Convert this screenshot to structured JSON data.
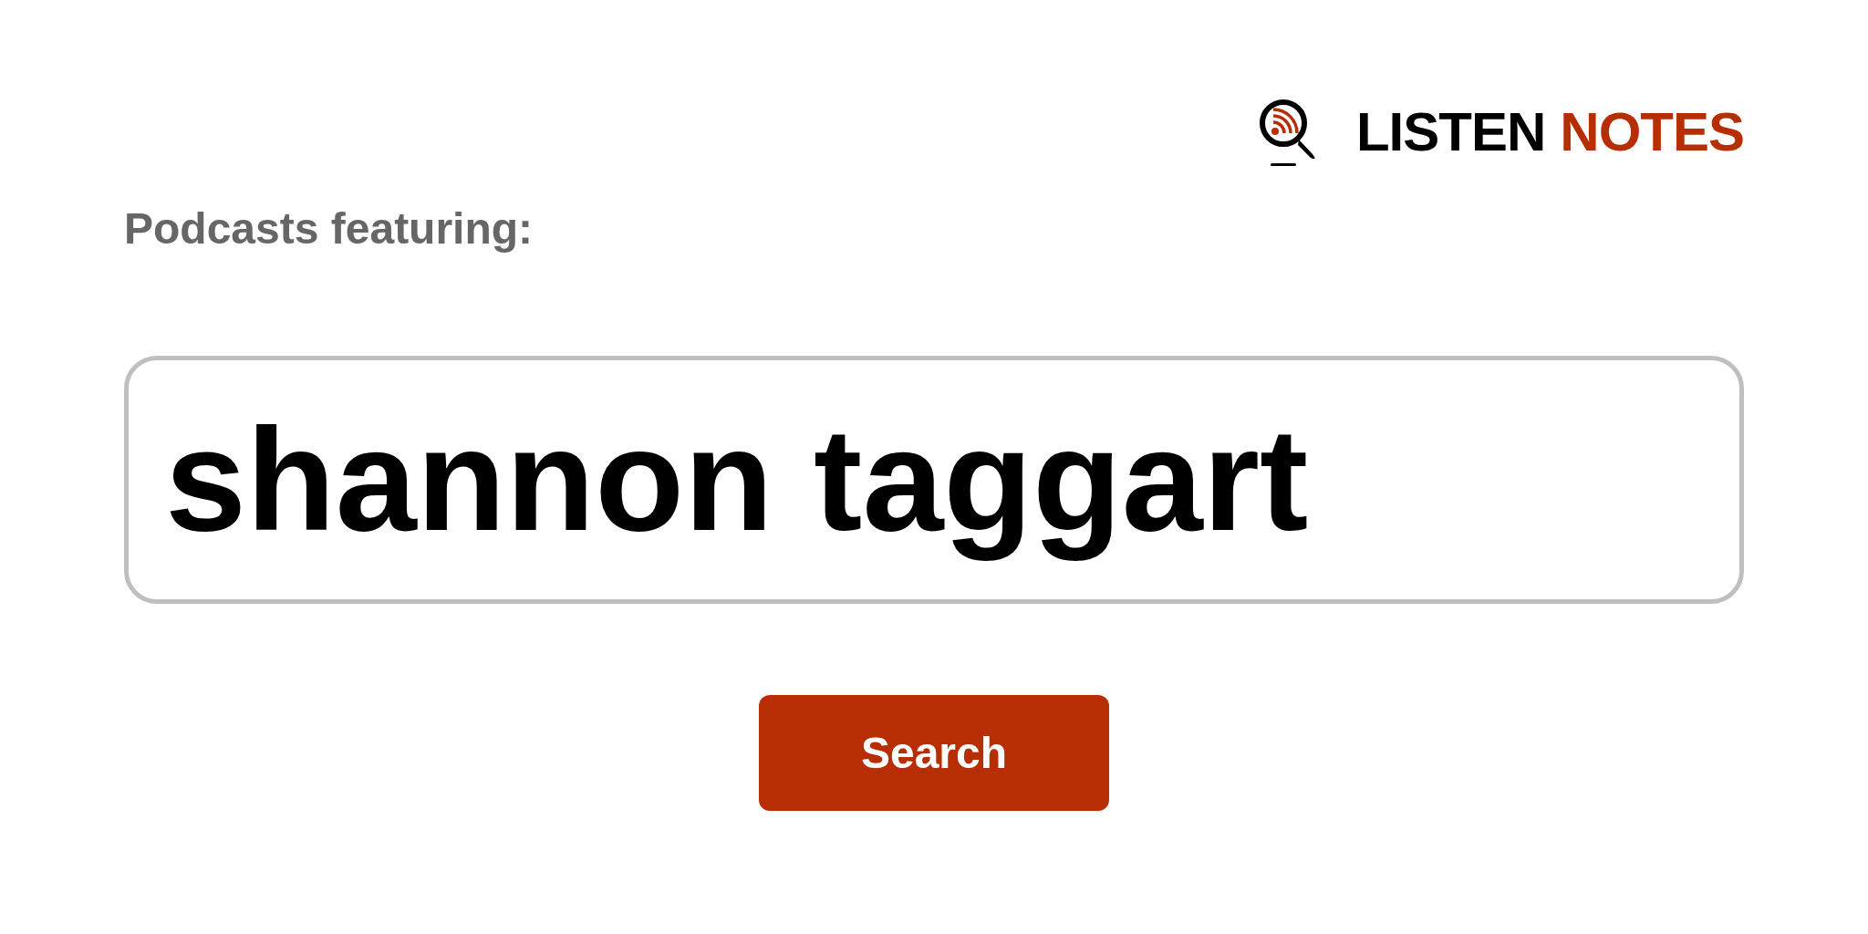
{
  "logo": {
    "primary": "LISTEN",
    "accent": "NOTES"
  },
  "heading": "Podcasts featuring:",
  "search": {
    "value": "shannon taggart"
  },
  "button": "Search"
}
